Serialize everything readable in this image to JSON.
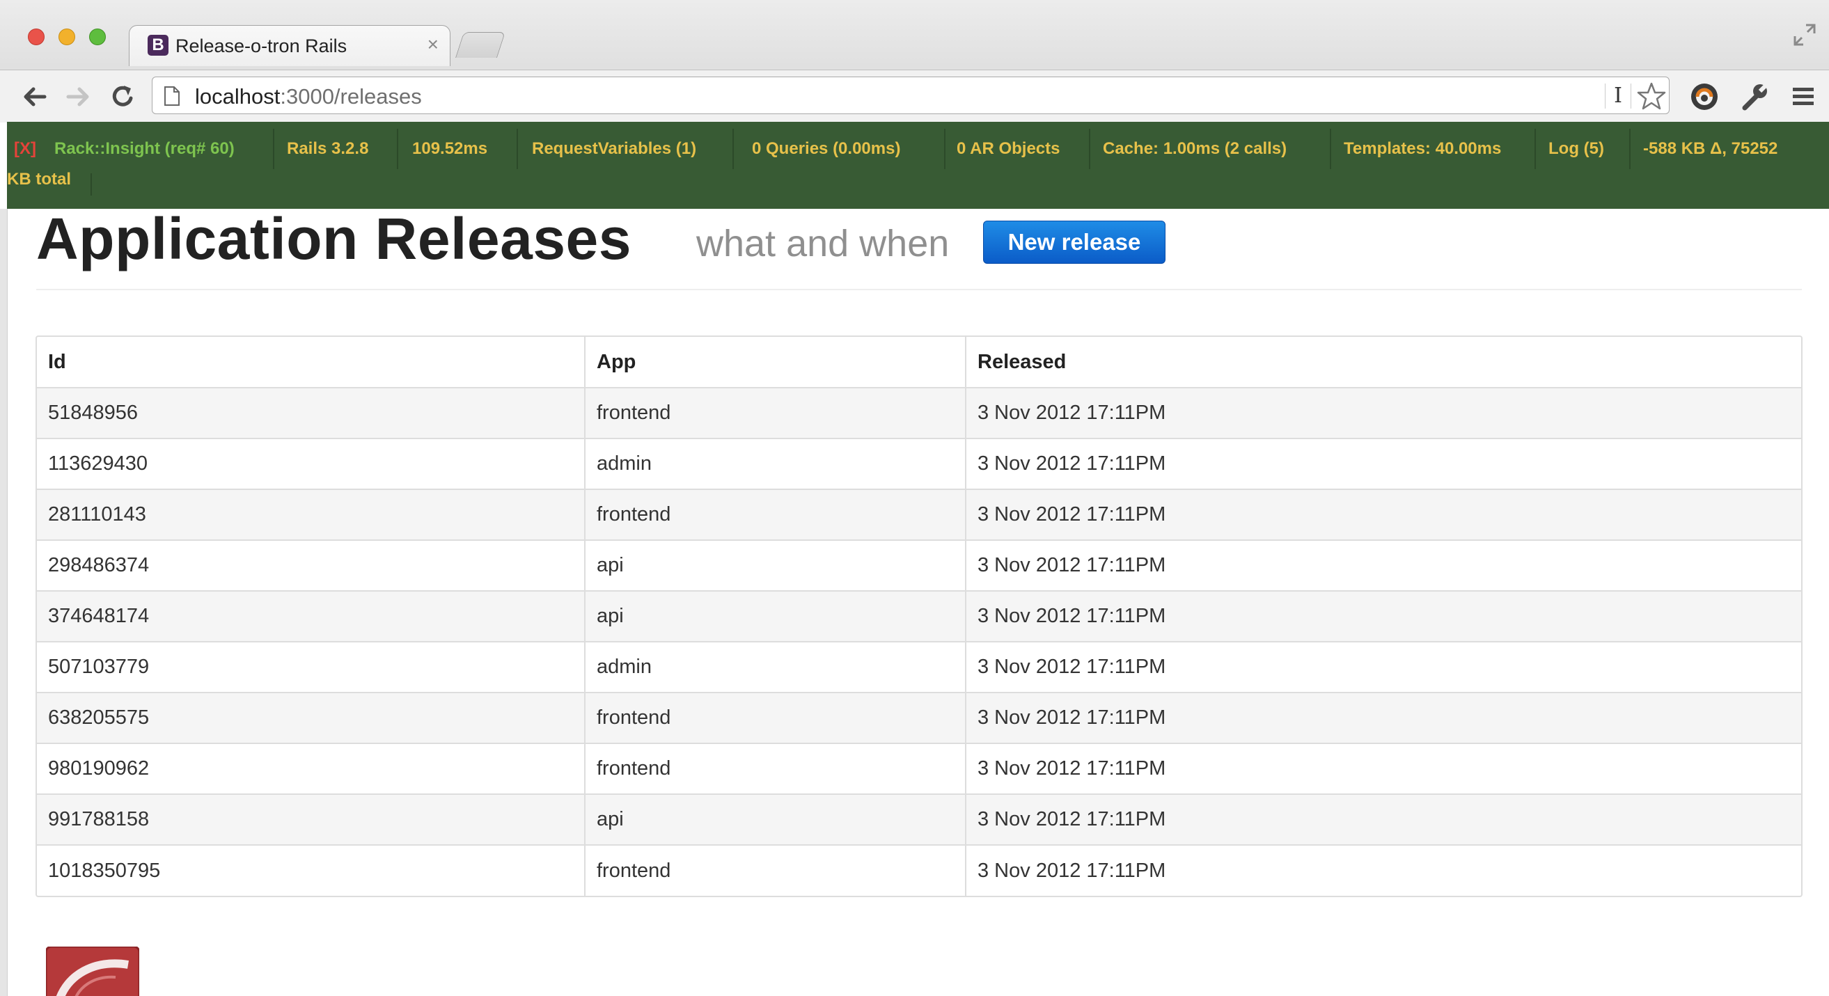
{
  "browser": {
    "tab_title": "Release-o-tron Rails",
    "tab_favicon_letter": "B",
    "tab_close": "×",
    "url_host": "localhost",
    "url_path": ":3000/releases",
    "ibeam_glyph": "I"
  },
  "insight_bar": {
    "close_label": "[X]",
    "items": [
      "Rack::Insight (req# 60)",
      "Rails 3.2.8",
      "109.52ms",
      "RequestVariables (1)",
      "0 Queries (0.00ms)",
      "0 AR Objects",
      "Cache: 1.00ms (2 calls)",
      "Templates: 40.00ms",
      "Log (5)",
      "-588 KB Δ, 75252",
      "KB total"
    ],
    "colors": {
      "background": "#385b34",
      "text": "#e7c14a",
      "close": "#e5433a",
      "first": "#7ec44f"
    }
  },
  "page": {
    "title": "Application Releases",
    "subtitle": "what and when",
    "new_button_label": "New release",
    "accent_color": "#1a6fd8"
  },
  "table": {
    "headers": {
      "id": "Id",
      "app": "App",
      "released": "Released"
    },
    "rows": [
      {
        "id": "51848956",
        "app": "frontend",
        "released": "3 Nov 2012 17:11PM"
      },
      {
        "id": "113629430",
        "app": "admin",
        "released": "3 Nov 2012 17:11PM"
      },
      {
        "id": "281110143",
        "app": "frontend",
        "released": "3 Nov 2012 17:11PM"
      },
      {
        "id": "298486374",
        "app": "api",
        "released": "3 Nov 2012 17:11PM"
      },
      {
        "id": "374648174",
        "app": "api",
        "released": "3 Nov 2012 17:11PM"
      },
      {
        "id": "507103779",
        "app": "admin",
        "released": "3 Nov 2012 17:11PM"
      },
      {
        "id": "638205575",
        "app": "frontend",
        "released": "3 Nov 2012 17:11PM"
      },
      {
        "id": "980190962",
        "app": "frontend",
        "released": "3 Nov 2012 17:11PM"
      },
      {
        "id": "991788158",
        "app": "api",
        "released": "3 Nov 2012 17:11PM"
      },
      {
        "id": "1018350795",
        "app": "frontend",
        "released": "3 Nov 2012 17:11PM"
      }
    ]
  },
  "icons": [
    "back-icon",
    "forward-icon",
    "reload-icon",
    "page-icon",
    "star-icon",
    "extension-icon",
    "wrench-icon",
    "menu-icon",
    "fullscreen-icon",
    "rails-logo"
  ]
}
